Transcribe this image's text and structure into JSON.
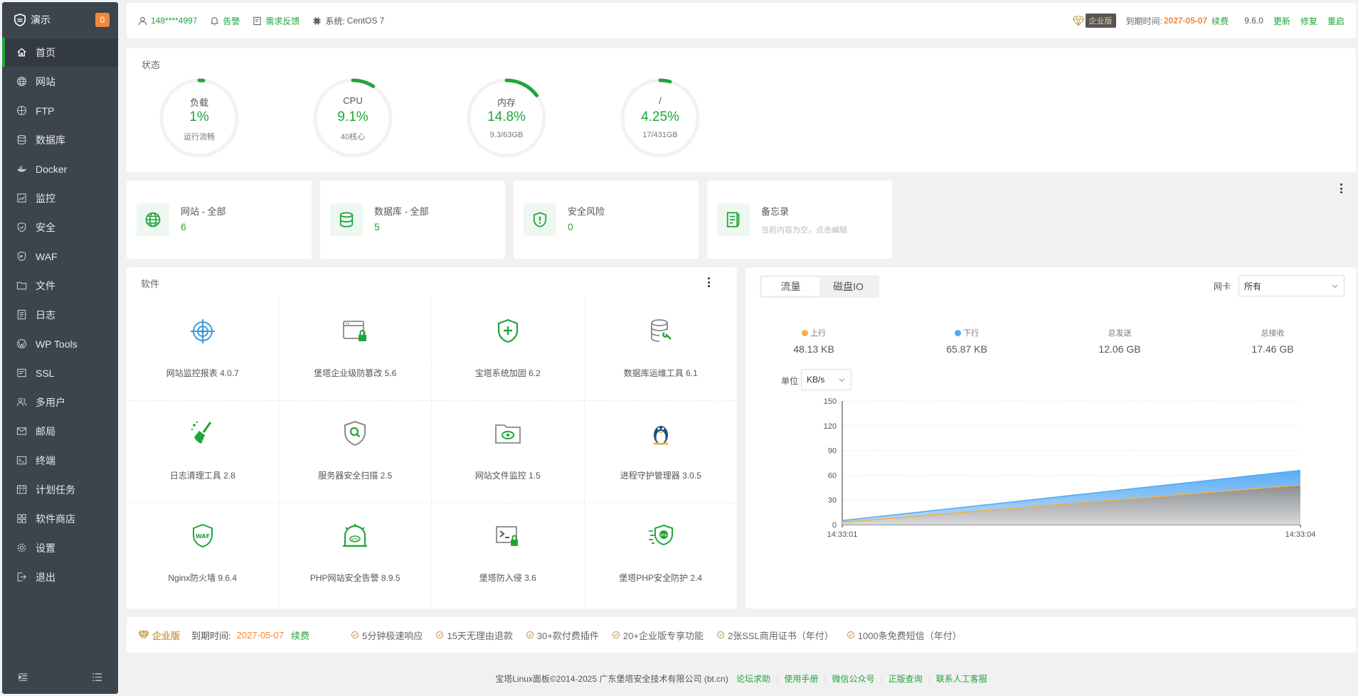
{
  "colors": {
    "accent": "#20a53a",
    "orange": "#f0883a",
    "sidebar": "#3c444d"
  },
  "sidebar": {
    "title": "演示",
    "badge": "0",
    "items": [
      {
        "label": "首页",
        "icon": "home-icon"
      },
      {
        "label": "网站",
        "icon": "globe-icon"
      },
      {
        "label": "FTP",
        "icon": "ftp-icon"
      },
      {
        "label": "数据库",
        "icon": "database-icon"
      },
      {
        "label": "Docker",
        "icon": "docker-icon"
      },
      {
        "label": "监控",
        "icon": "monitor-icon"
      },
      {
        "label": "安全",
        "icon": "shield-icon"
      },
      {
        "label": "WAF",
        "icon": "waf-icon"
      },
      {
        "label": "文件",
        "icon": "folder-icon"
      },
      {
        "label": "日志",
        "icon": "log-icon"
      },
      {
        "label": "WP Tools",
        "icon": "wordpress-icon"
      },
      {
        "label": "SSL",
        "icon": "ssl-icon"
      },
      {
        "label": "多用户",
        "icon": "users-icon"
      },
      {
        "label": "邮局",
        "icon": "mail-icon"
      },
      {
        "label": "终端",
        "icon": "terminal-icon"
      },
      {
        "label": "计划任务",
        "icon": "calendar-icon"
      },
      {
        "label": "软件商店",
        "icon": "apps-icon"
      },
      {
        "label": "设置",
        "icon": "gear-icon"
      },
      {
        "label": "退出",
        "icon": "logout-icon"
      }
    ]
  },
  "topbar": {
    "user": "148****4997",
    "alarm": "告警",
    "feedback": "需求反馈",
    "system_label": "系统:",
    "system_value": "CentOS 7",
    "edition": "企业版",
    "expire_label": "到期时间:",
    "expire_date": "2027-05-07",
    "renew": "续费",
    "version": "9.6.0",
    "update": "更新",
    "repair": "修复",
    "restart": "重启"
  },
  "status": {
    "title": "状态",
    "gauges": [
      {
        "label": "负载",
        "value": "1%",
        "sub": "运行流畅",
        "percent": 1
      },
      {
        "label": "CPU",
        "value": "9.1%",
        "sub": "40核心",
        "percent": 9.1
      },
      {
        "label": "内存",
        "value": "14.8%",
        "sub": "9.3/63GB",
        "percent": 14.8
      },
      {
        "label": "/",
        "value": "4.25%",
        "sub": "17/431GB",
        "percent": 4.25
      }
    ]
  },
  "overview": [
    {
      "name": "网站 - 全部",
      "value": "6",
      "icon": "globe-icon"
    },
    {
      "name": "数据库 - 全部",
      "value": "5",
      "icon": "database-icon"
    },
    {
      "name": "安全风险",
      "value": "0",
      "icon": "shield-alert-icon"
    },
    {
      "name": "备忘录",
      "hint": "当前内容为空，点击编辑",
      "icon": "memo-icon"
    }
  ],
  "software": {
    "title": "软件",
    "items": [
      {
        "name": "网站监控报表 4.0.7",
        "icon": "site-monitor-icon"
      },
      {
        "name": "堡塔企业级防篡改 5.6",
        "icon": "anti-tamper-icon"
      },
      {
        "name": "宝塔系统加固 6.2",
        "icon": "system-harden-icon"
      },
      {
        "name": "数据库运维工具 6.1",
        "icon": "db-tool-icon"
      },
      {
        "name": "日志清理工具 2.8",
        "icon": "broom-icon"
      },
      {
        "name": "服务器安全扫描 2.5",
        "icon": "security-scan-icon"
      },
      {
        "name": "网站文件监控 1.5",
        "icon": "file-monitor-icon"
      },
      {
        "name": "进程守护管理器 3.0.5",
        "icon": "penguin-icon"
      },
      {
        "name": "Nginx防火墙 9.6.4",
        "icon": "waf-shield-icon"
      },
      {
        "name": "PHP网站安全告警 8.9.5",
        "icon": "php-alarm-icon"
      },
      {
        "name": "堡塔防入侵 3.6",
        "icon": "terminal-lock-icon"
      },
      {
        "name": "堡塔PHP安全防护 2.4",
        "icon": "php-shield-icon"
      }
    ]
  },
  "traffic": {
    "tabs": [
      "流量",
      "磁盘IO"
    ],
    "nic_label": "网卡",
    "nic_value": "所有",
    "unit_label": "单位",
    "unit_value": "KB/s",
    "stats": [
      {
        "label": "上行",
        "value": "48.13 KB",
        "dot": "#f5b041"
      },
      {
        "label": "下行",
        "value": "65.87 KB",
        "dot": "#52a8f5"
      },
      {
        "label": "总发送",
        "value": "12.06 GB"
      },
      {
        "label": "总接收",
        "value": "17.46 GB"
      }
    ]
  },
  "chart_data": {
    "type": "area",
    "x": [
      "14:33:01",
      "14:33:04"
    ],
    "series": [
      {
        "name": "上行",
        "values": [
          3,
          48.13
        ],
        "color": "#f5b041"
      },
      {
        "name": "下行",
        "values": [
          5,
          65.87
        ],
        "color": "#52a8f5"
      }
    ],
    "ylim": [
      0,
      150
    ],
    "yticks": [
      0,
      30,
      60,
      90,
      120,
      150
    ],
    "grid": true
  },
  "enterprise": {
    "name": "企业版",
    "expire_label": "到期时间:",
    "expire_date": "2027-05-07",
    "renew": "续费",
    "features": [
      "5分钟极速响应",
      "15天无理由退款",
      "30+款付费插件",
      "20+企业版专享功能",
      "2张SSL商用证书（年付）",
      "1000条免费短信（年付）"
    ]
  },
  "footer": {
    "copyright": "宝塔Linux面板©2014-2025 广东堡塔安全技术有限公司 (bt.cn)",
    "links": [
      "论坛求助",
      "使用手册",
      "微信公众号",
      "正版查询",
      "联系人工客服"
    ]
  }
}
